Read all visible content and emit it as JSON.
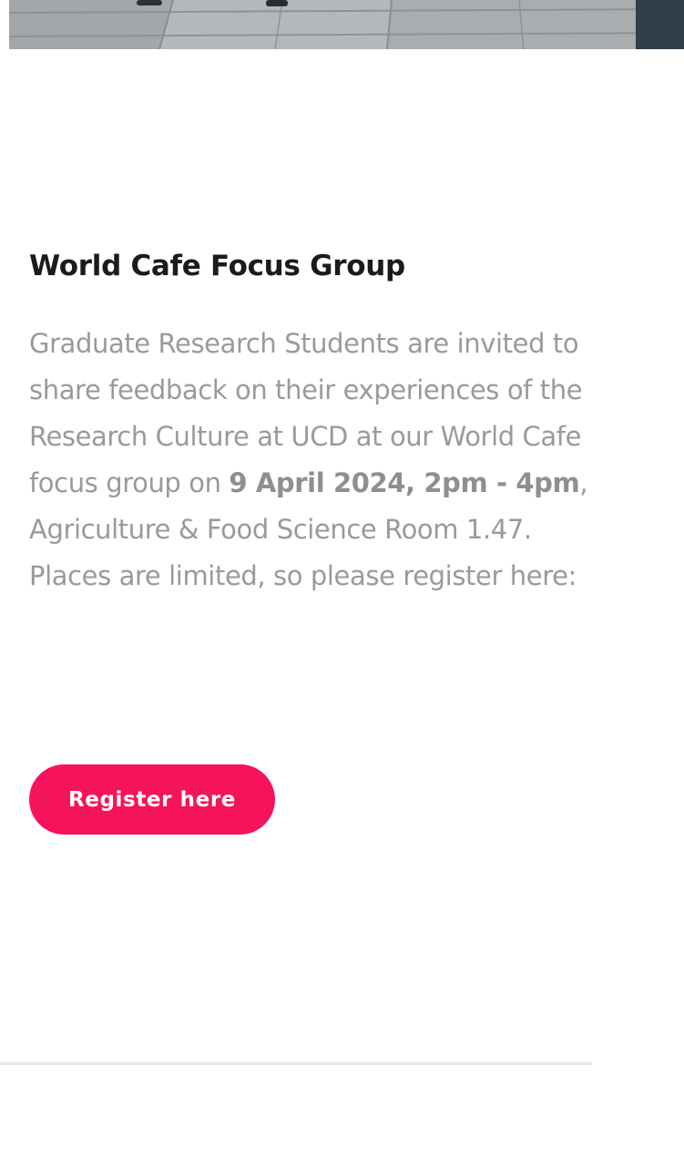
{
  "event": {
    "title": "World Cafe Focus Group",
    "description": {
      "intro": "Graduate Research Students are invited to share feedback on their experiences of the Research Culture at UCD at our World Cafe focus group on ",
      "date_time": "9 April 2024, 2pm - 4pm",
      "outro": ", Agriculture & Food Science Room 1.47. Places are limited, so please register here:"
    },
    "register_label": "Register here"
  },
  "colors": {
    "accent": "#f5135b",
    "title": "#1b1b1b",
    "body_text": "#9a9a9a",
    "divider": "#e7e7e7"
  }
}
